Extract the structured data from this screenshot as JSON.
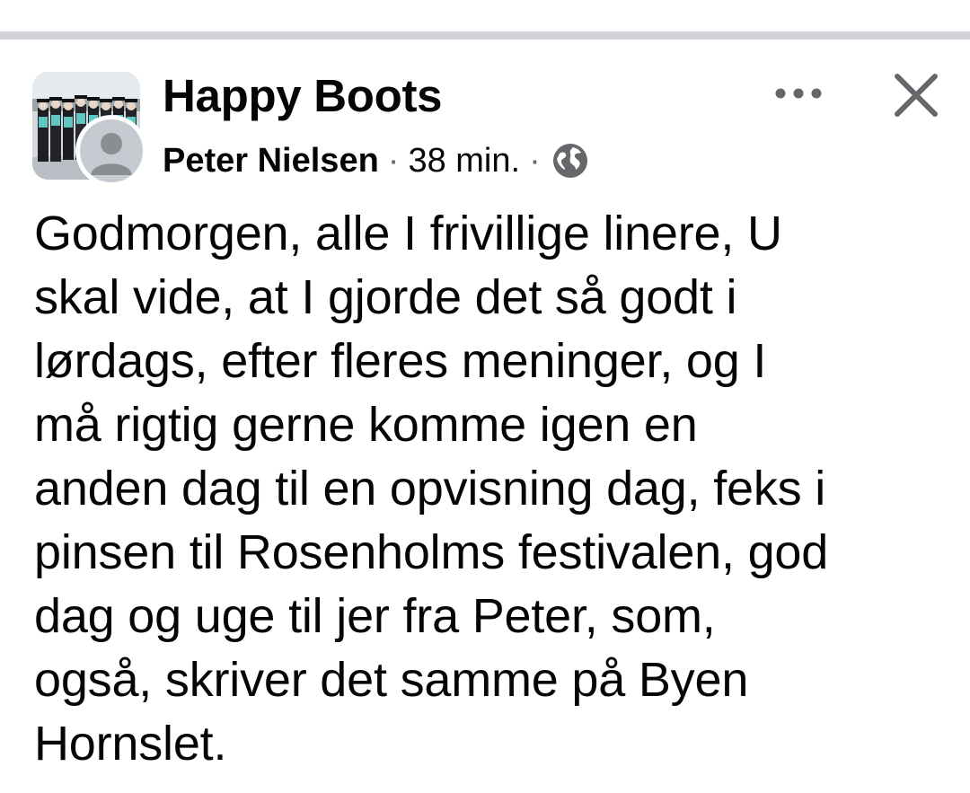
{
  "post": {
    "group_name": "Happy Boots",
    "author_name": "Peter Nielsen",
    "separator": "·",
    "timestamp": "38 min.",
    "audience_icon": "globe-icon",
    "more_icon": "more-horizontal-icon",
    "close_icon": "close-icon",
    "body": "Godmorgen, alle I frivillige linere, U\nskal vide, at I gjorde det så godt i\nlørdags, efter fleres meninger, og I\nmå rigtig gerne komme igen en\nanden dag til en opvisning dag, feks i\npinsen til Rosenholms festivalen, god\ndag og uge til jer fra Peter, som,\nogså, skriver det samme på Byen\nHornslet."
  },
  "colors": {
    "text_primary": "#050505",
    "text_secondary": "#65676b",
    "divider": "#cfd3d8",
    "icon": "#65676b"
  }
}
